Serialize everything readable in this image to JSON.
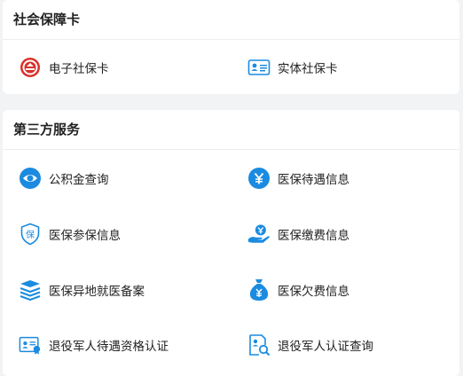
{
  "social_card": {
    "title": "社会保障卡",
    "items": [
      {
        "label": "电子社保卡",
        "icon": "emblem-icon"
      },
      {
        "label": "实体社保卡",
        "icon": "id-card-icon"
      }
    ]
  },
  "third_party": {
    "title": "第三方服务",
    "items": [
      {
        "label": "公积金查询",
        "icon": "eye-icon"
      },
      {
        "label": "医保待遇信息",
        "icon": "yen-circle-icon"
      },
      {
        "label": "医保参保信息",
        "icon": "shield-icon"
      },
      {
        "label": "医保缴费信息",
        "icon": "hand-yen-icon"
      },
      {
        "label": "医保异地就医备案",
        "icon": "stack-icon"
      },
      {
        "label": "医保欠费信息",
        "icon": "money-bag-icon"
      },
      {
        "label": "退役军人待遇资格认证",
        "icon": "certificate-icon"
      },
      {
        "label": "退役军人认证查询",
        "icon": "document-search-icon"
      }
    ]
  },
  "colors": {
    "accent": "#1a8be0",
    "emblem": "#d9302a"
  }
}
